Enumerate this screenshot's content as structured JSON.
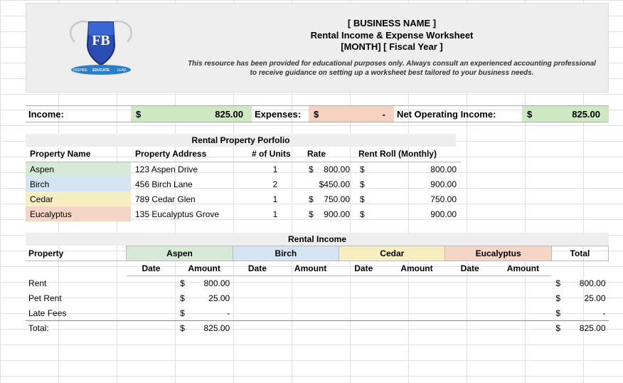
{
  "header": {
    "line1": "[ BUSINESS NAME ]",
    "line2": "Rental Income & Expense Worksheet",
    "line3": "[MONTH] [ Fiscal Year ]",
    "disclaimer": "This resource has been provided for educational purposes only. Always consult an experienced accounting professional to receive guidance on setting up a worksheet best tailored to your business needs.",
    "logo_text": "FB",
    "logo_tagline_left": "INSPIRE",
    "logo_tagline_mid": "EDUCATE",
    "logo_tagline_right": "LEAD"
  },
  "summary": {
    "income_label": "Income:",
    "income_value": "825.00",
    "expenses_label": "Expenses:",
    "expenses_value": "-",
    "noi_label": "Net Operating Income:",
    "noi_value": "825.00",
    "dollar": "$"
  },
  "portfolio": {
    "title": "Rental Property Porfolio",
    "headers": {
      "name": "Property Name",
      "addr": "Property Address",
      "units": "# of Units",
      "rate": "Rate",
      "roll": "Rent Roll (Monthly)"
    },
    "rows": [
      {
        "name": "Aspen",
        "addr": "123 Aspen Drive",
        "units": "1",
        "rate": "800.00",
        "roll": "800.00",
        "cls": "prop-aspen"
      },
      {
        "name": "Birch",
        "addr": "456 Birch Lane",
        "units": "2",
        "rate": "450.00",
        "roll": "900.00",
        "cls": "prop-birch",
        "rate_nodollar": true
      },
      {
        "name": "Cedar",
        "addr": "789 Cedar Glen",
        "units": "1",
        "rate": "750.00",
        "roll": "750.00",
        "cls": "prop-cedar"
      },
      {
        "name": "Eucalyptus",
        "addr": "135 Eucalyptus Grove",
        "units": "1",
        "rate": "900.00",
        "roll": "900.00",
        "cls": "prop-euc"
      }
    ]
  },
  "rental_income": {
    "title": "Rental Income",
    "property_label": "Property",
    "total_label": "Total",
    "date_label": "Date",
    "amount_label": "Amount",
    "props": [
      "Aspen",
      "Birch",
      "Cedar",
      "Eucalyptus"
    ],
    "prop_cls": [
      "prop-aspen",
      "prop-birch",
      "prop-cedar",
      "prop-euc"
    ],
    "rows": [
      {
        "label": "Rent",
        "amounts": [
          "800.00",
          "",
          "",
          ""
        ],
        "total": "800.00"
      },
      {
        "label": "Pet Rent",
        "amounts": [
          "25.00",
          "",
          "",
          ""
        ],
        "total": "25.00"
      },
      {
        "label": "Late Fees",
        "amounts": [
          "-",
          "",
          "",
          ""
        ],
        "total": "-"
      }
    ],
    "total_row": {
      "label": "Total:",
      "amounts": [
        "825.00",
        "",
        "",
        ""
      ],
      "total": "825.00"
    }
  }
}
